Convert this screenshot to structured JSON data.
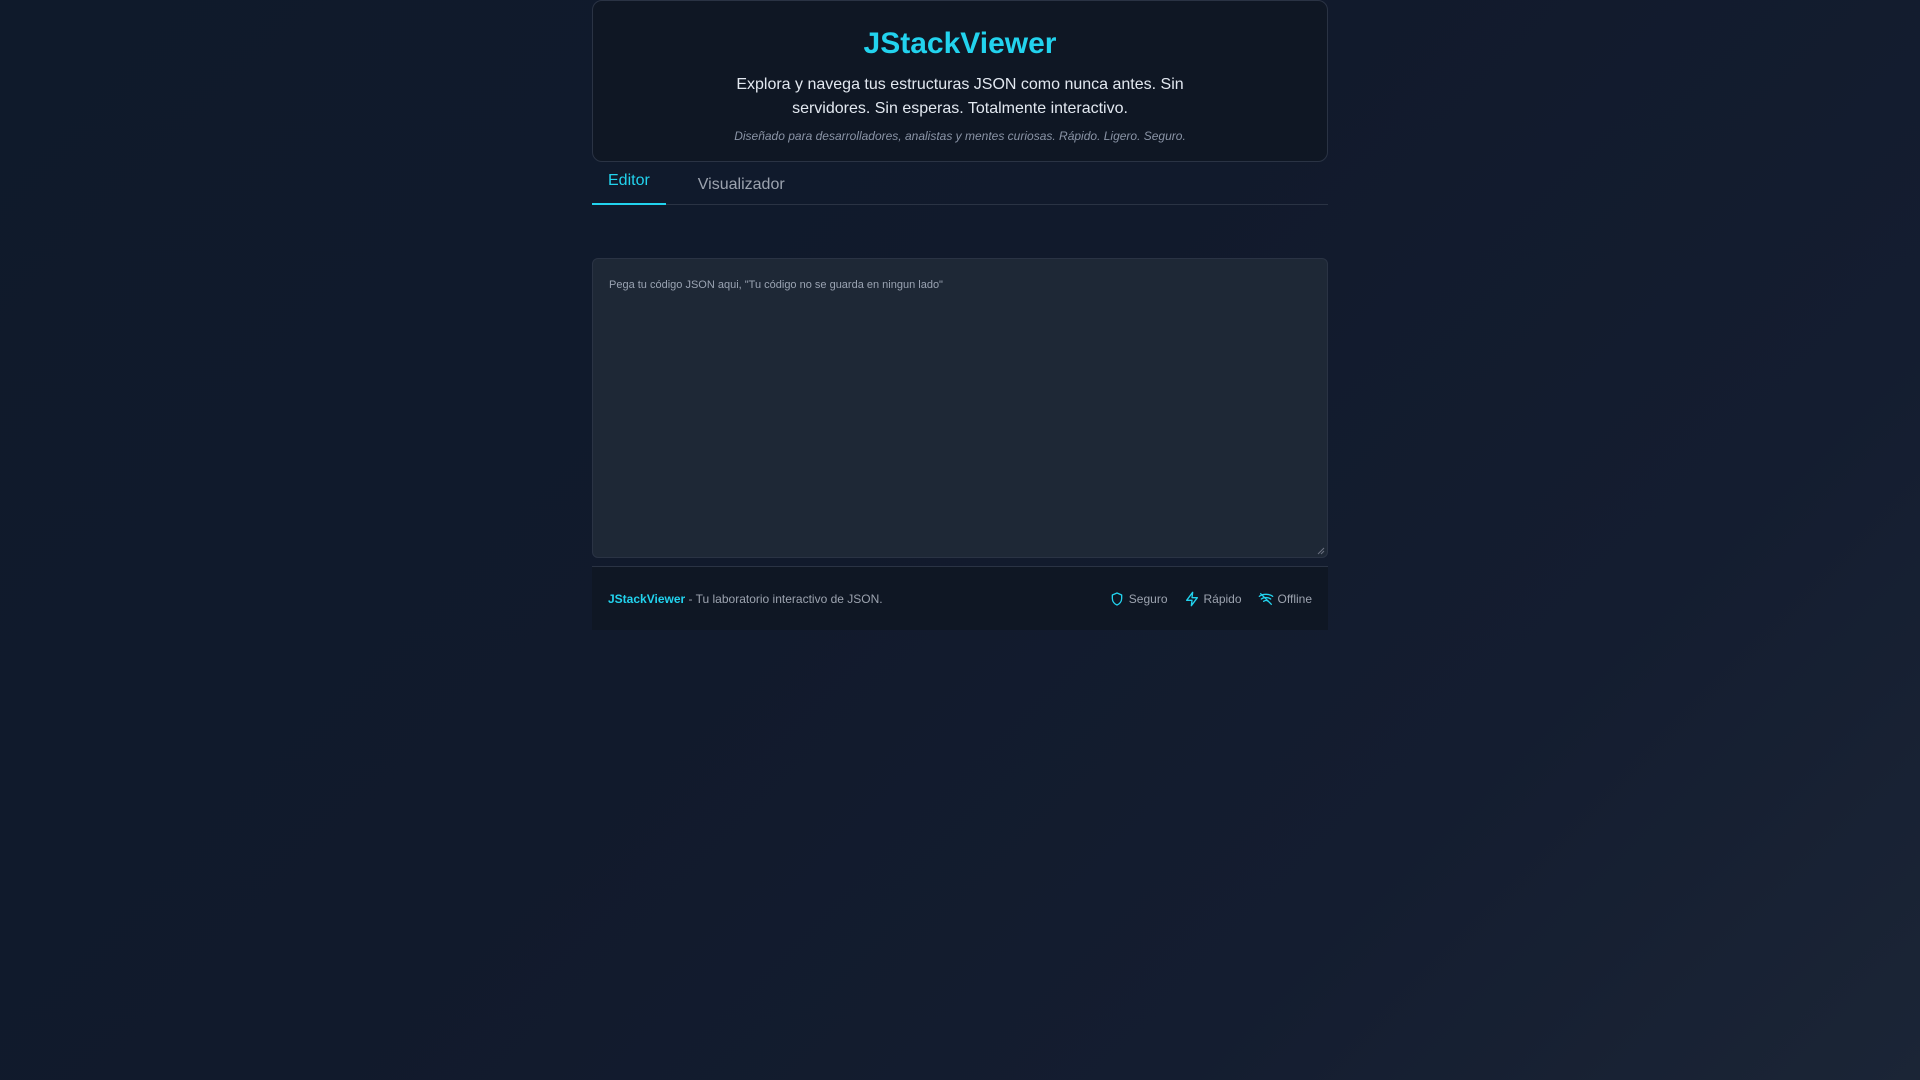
{
  "header": {
    "title": "JStackViewer",
    "subtitle": "Explora y navega tus estructuras JSON como nunca antes. Sin servidores. Sin esperas. Totalmente interactivo.",
    "tagline": "Diseñado para desarrolladores, analistas y mentes curiosas. Rápido. Ligero. Seguro."
  },
  "tabs": [
    {
      "label": "Editor",
      "active": true
    },
    {
      "label": "Visualizador",
      "active": false
    }
  ],
  "editor": {
    "value": "",
    "placeholder": "Pega tu código JSON aqui, \"Tu código no se guarda en ningun lado\""
  },
  "footer": {
    "brand": "JStackViewer",
    "description": " - Tu laboratorio interactivo de JSON.",
    "badges": [
      {
        "label": "Seguro",
        "icon": "shield-icon"
      },
      {
        "label": "Rápido",
        "icon": "lightning-icon"
      },
      {
        "label": "Offline",
        "icon": "wifi-off-icon"
      }
    ]
  },
  "colors": {
    "accent": "#22d3ee",
    "background": "#111a2c",
    "panel": "#0f1724",
    "editor": "#1e2836",
    "border": "#2a3344"
  }
}
